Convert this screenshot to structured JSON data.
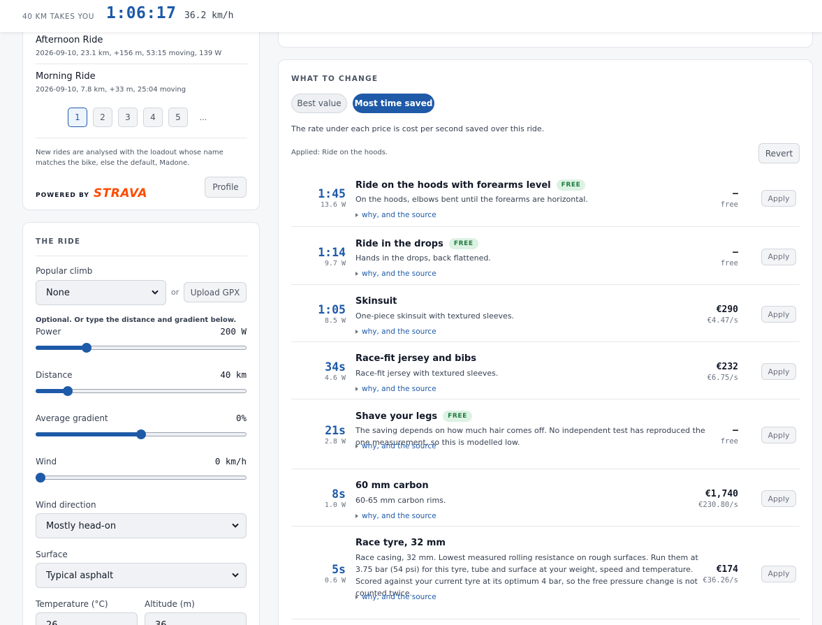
{
  "header": {
    "label": "40 KM TAKES YOU",
    "time": "1:06:17",
    "speed": "36.2 km/h"
  },
  "rides": {
    "items": [
      {
        "name": "Afternoon Ride",
        "meta": "2026-09-10, 23.1 km, +156 m, 53:15 moving, 139 W"
      },
      {
        "name": "Morning Ride",
        "meta": "2026-09-10, 7.8 km, +33 m, 25:04 moving"
      }
    ],
    "pages": [
      "1",
      "2",
      "3",
      "4",
      "5"
    ],
    "ellipsis": "...",
    "note": "New rides are analysed with the loadout whose name matches the bike, else the default, Madone.",
    "powered_by": "POWERED BY",
    "strava": "STRAVA",
    "profile_label": "Profile"
  },
  "ride": {
    "title": "THE RIDE",
    "popular_climb_label": "Popular climb",
    "popular_climb_value": "None",
    "or": "or",
    "upload_gpx": "Upload GPX",
    "optional_note": "Optional. Or type the distance and gradient below.",
    "power": {
      "label": "Power",
      "value": "200 W",
      "fraction": 0.23
    },
    "distance": {
      "label": "Distance",
      "value": "40 km",
      "fraction": 0.135
    },
    "gradient": {
      "label": "Average gradient",
      "value": "0%",
      "fraction": 0.5
    },
    "wind": {
      "label": "Wind",
      "value": "0 km/h",
      "fraction": 0.0
    },
    "wind_direction_label": "Wind direction",
    "wind_direction_value": "Mostly head-on",
    "surface_label": "Surface",
    "surface_value": "Typical asphalt",
    "temperature_label": "Temperature (°C)",
    "temperature_value": "26",
    "altitude_label": "Altitude (m)",
    "altitude_value": "36"
  },
  "change": {
    "title": "WHAT TO CHANGE",
    "tab_best": "Best value",
    "tab_most": "Most time saved",
    "rate_note": "The rate under each price is cost per second saved over this ride.",
    "applied": "Applied: Ride on the hoods.",
    "revert": "Revert",
    "source_link": "why, and the source",
    "apply_label": "Apply",
    "free_badge": "FREE",
    "items": [
      {
        "saved": "1:45",
        "watts": "13.6 W",
        "title": "Ride on the hoods with forearms level",
        "free": true,
        "desc": "On the hoods, elbows bent until the forearms are horizontal.",
        "price": "–",
        "rate": "free"
      },
      {
        "saved": "1:14",
        "watts": "9.7 W",
        "title": "Ride in the drops",
        "free": true,
        "desc": "Hands in the drops, back flattened.",
        "price": "–",
        "rate": "free"
      },
      {
        "saved": "1:05",
        "watts": "8.5 W",
        "title": "Skinsuit",
        "free": false,
        "desc": "One-piece skinsuit with textured sleeves.",
        "price": "€290",
        "rate": "€4.47/s"
      },
      {
        "saved": "34s",
        "watts": "4.6 W",
        "title": "Race-fit jersey and bibs",
        "free": false,
        "desc": "Race-fit jersey with textured sleeves.",
        "price": "€232",
        "rate": "€6.75/s"
      },
      {
        "saved": "21s",
        "watts": "2.8 W",
        "title": "Shave your legs",
        "free": true,
        "desc": "The saving depends on how much hair comes off. No independent test has reproduced the one measurement, so this is modelled low.",
        "price": "–",
        "rate": "free"
      },
      {
        "saved": "8s",
        "watts": "1.0 W",
        "title": "60 mm carbon",
        "free": false,
        "desc": "60-65 mm carbon rims.",
        "price": "€1,740",
        "rate": "€230.80/s"
      },
      {
        "saved": "5s",
        "watts": "0.6 W",
        "title": "Race tyre, 32 mm",
        "free": false,
        "desc": "Race casing, 32 mm. Lowest measured rolling resistance on rough surfaces. Run them at 3.75 bar (54 psi) for this tyre, tube and surface at your weight, speed and temperature. Scored against your current tyre at its optimum 4 bar, so the free pressure change is not counted twice.",
        "price": "€174",
        "rate": "€36.26/s"
      }
    ]
  }
}
